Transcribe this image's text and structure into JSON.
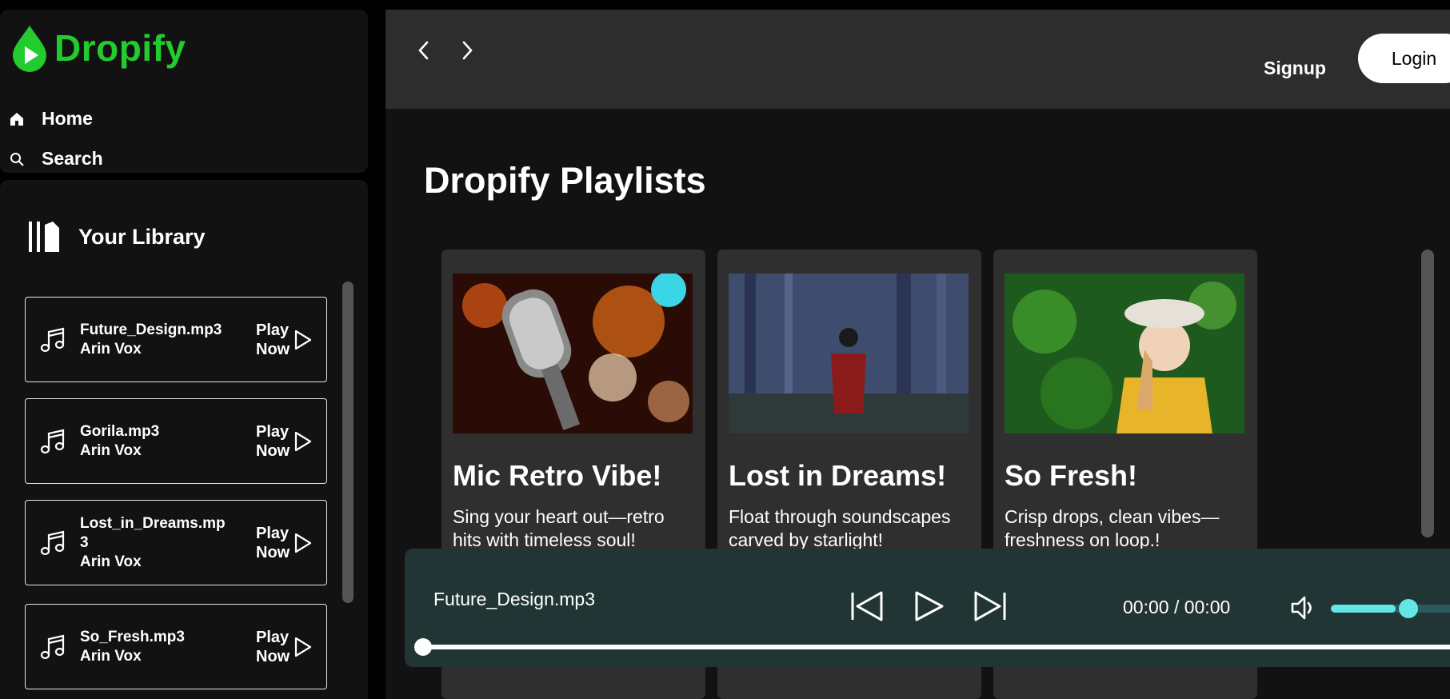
{
  "brand": {
    "name": "Dropify",
    "color": "#22cc2e"
  },
  "nav": {
    "home": "Home",
    "search": "Search"
  },
  "library": {
    "title": "Your Library",
    "play_label_1": "Play",
    "play_label_2": "Now",
    "songs": [
      {
        "file": "Future_Design.mp3",
        "artist": "Arin Vox"
      },
      {
        "file": "Gorila.mp3",
        "artist": "Arin Vox"
      },
      {
        "file": "Lost_in_Dreams.mp3",
        "artist": "Arin Vox"
      },
      {
        "file": "So_Fresh.mp3",
        "artist": "Arin Vox"
      }
    ]
  },
  "header": {
    "signup": "Signup",
    "login": "Login"
  },
  "main": {
    "title": "Dropify Playlists",
    "playlists": [
      {
        "name": "Mic Retro Vibe!",
        "desc": "Sing your heart out—retro hits with timeless soul!"
      },
      {
        "name": "Lost in Dreams!",
        "desc": "Float through soundscapes carved by starlight!"
      },
      {
        "name": "So Fresh!",
        "desc": "Crisp drops, clean vibes—freshness on loop.!"
      }
    ]
  },
  "player": {
    "now_playing": "Future_Design.mp3",
    "time": "00:00 / 00:00",
    "volume_percent": 45,
    "progress_percent": 0,
    "accent": "#63e6e6",
    "bg": "#223535"
  }
}
